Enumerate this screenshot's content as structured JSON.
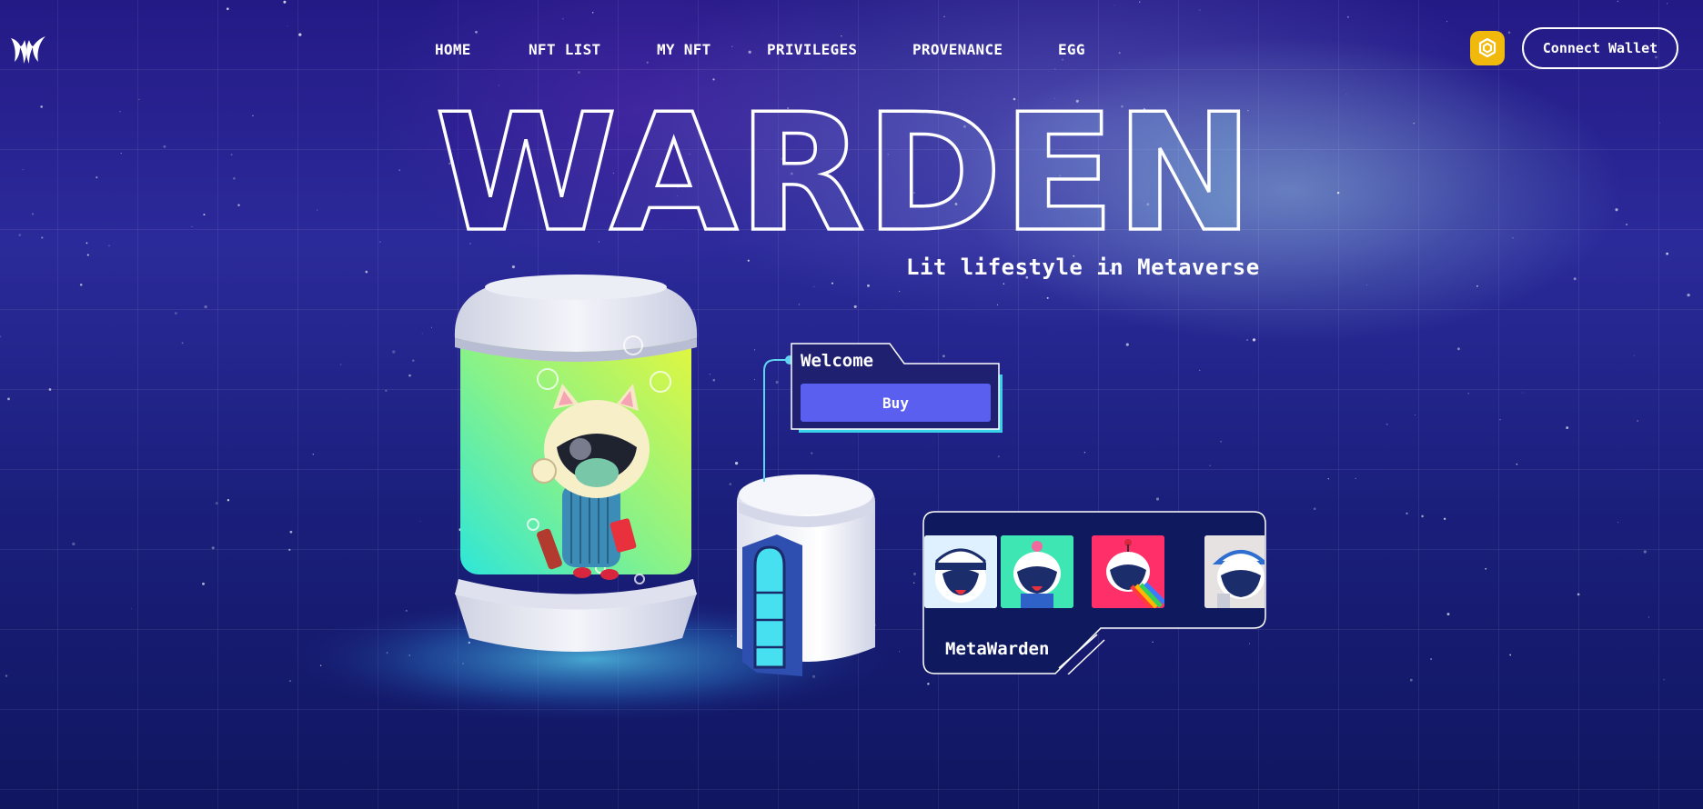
{
  "nav": {
    "items": [
      {
        "label": "HOME"
      },
      {
        "label": "NFT LIST"
      },
      {
        "label": "MY NFT"
      },
      {
        "label": "PRIVILEGES"
      },
      {
        "label": "PROVENANCE"
      },
      {
        "label": "EGG"
      }
    ]
  },
  "header": {
    "wallet_button": "Connect Wallet",
    "chain_icon": "bnb-chain-icon",
    "logo_icon": "warden-logo-icon"
  },
  "hero": {
    "title": "WARDEN",
    "tagline": "Lit lifestyle in Metaverse"
  },
  "welcome_card": {
    "title": "Welcome",
    "buy_label": "Buy"
  },
  "collection_card": {
    "title": "MetaWarden",
    "thumbnails": [
      {
        "icon": "captain-warden-avatar",
        "bg": "#ffffff"
      },
      {
        "icon": "pink-flower-warden-avatar",
        "bg": "#3ee6b4"
      },
      {
        "icon": "rainbow-warden-avatar",
        "bg": "#ff2f6a"
      },
      {
        "icon": "cap-warden-avatar",
        "bg": "#e7e2e2"
      }
    ]
  },
  "colors": {
    "accent": "#5b5ff0",
    "cyan": "#4ee0f0",
    "bnb": "#f0b90b"
  }
}
